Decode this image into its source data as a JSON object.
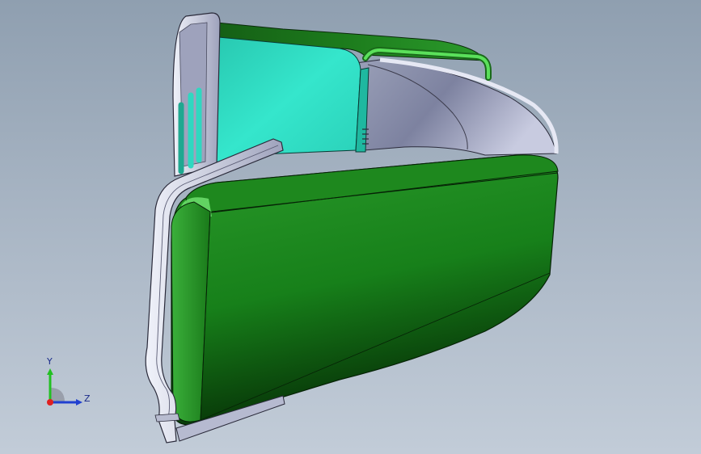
{
  "viewport": {
    "background_top": "#8f9fb0",
    "background_bottom": "#c2ccd8"
  },
  "model": {
    "body_color": "#1f8a1f",
    "body_dark_color": "#0b3a0b",
    "inner_face_color": "#2fe0c6",
    "frame_color": "#d8dbe8",
    "edge_color": "#0a2a0a",
    "pipe_color": "#4fd84f"
  },
  "triad": {
    "y_label": "Y",
    "z_label": "Z",
    "y_color": "#22c022",
    "z_color": "#2040d0",
    "x_color": "#e02020"
  }
}
